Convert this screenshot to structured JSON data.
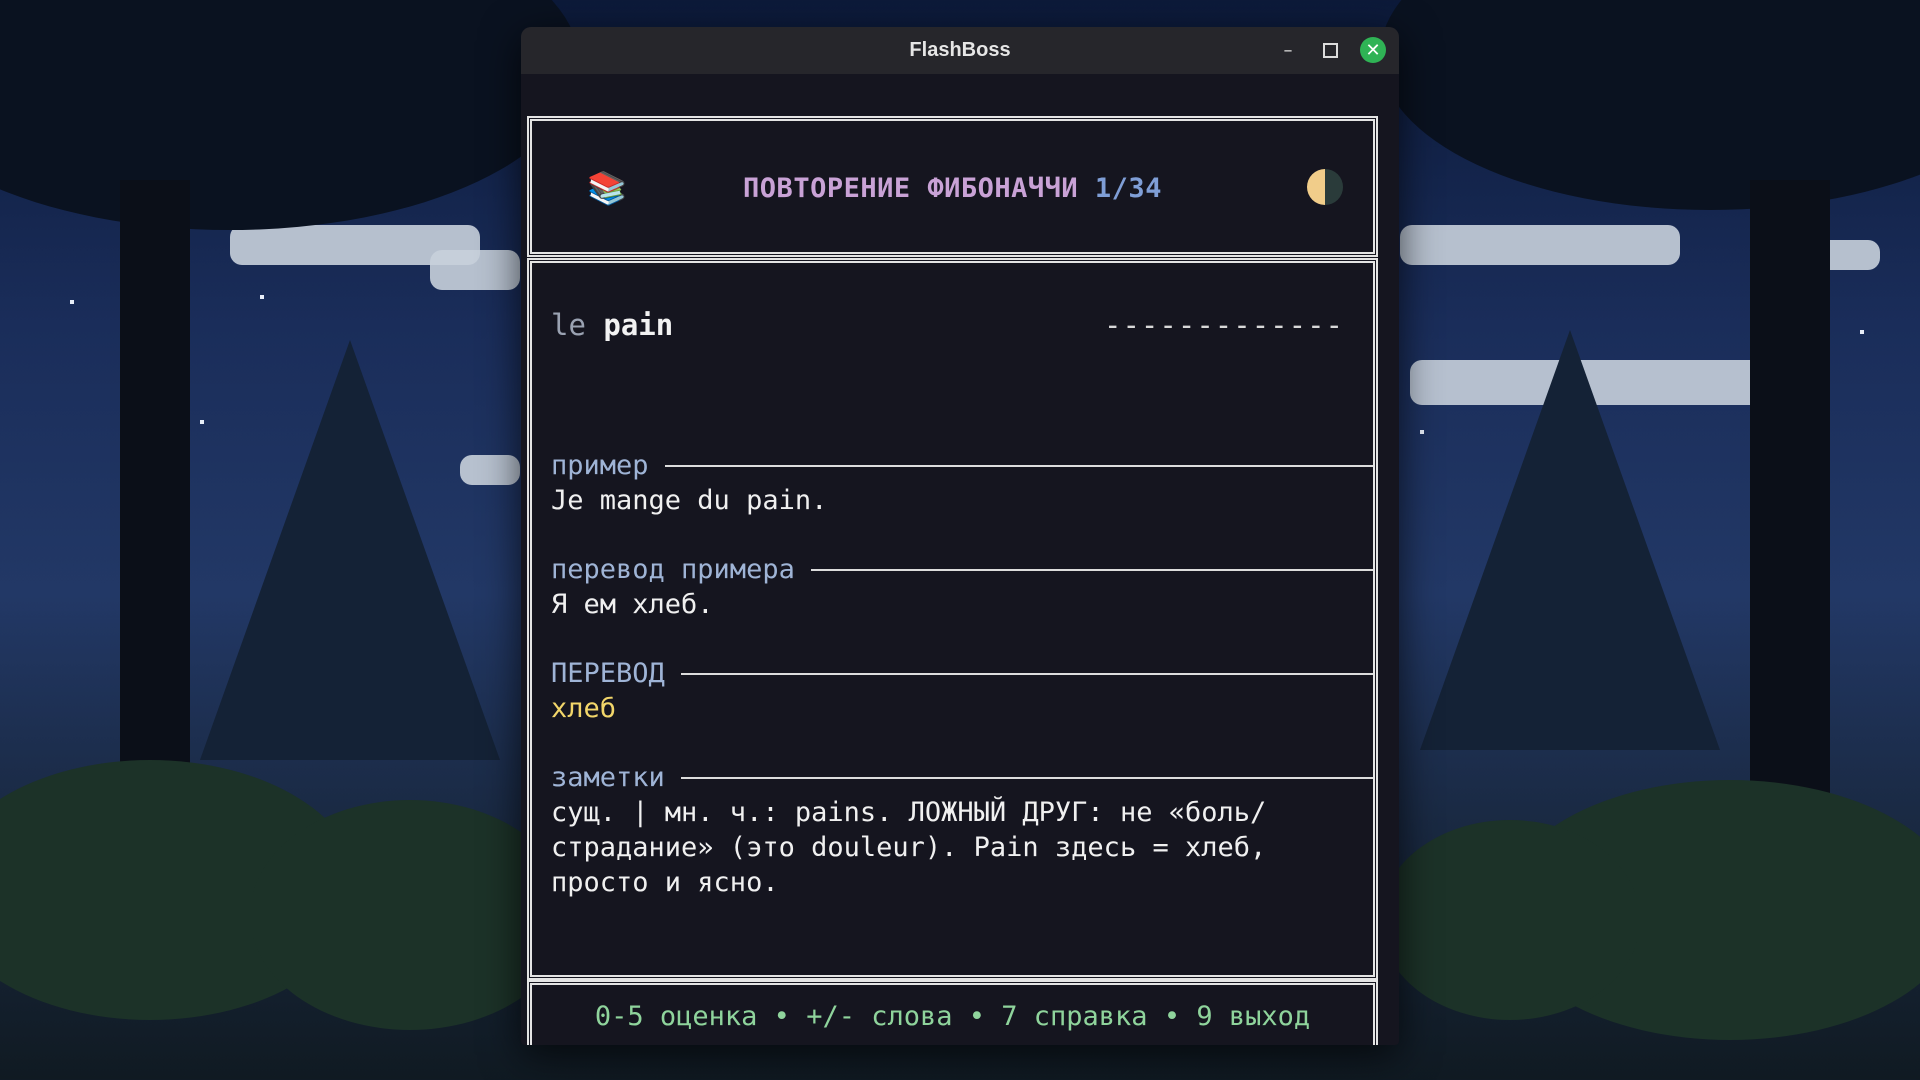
{
  "window": {
    "title": "FlashBoss",
    "minimize": "–",
    "close": "✕"
  },
  "header": {
    "book_icon": "📚",
    "title": "ПОВТОРЕНИЕ ФИБОНАЧЧИ",
    "progress": "1/34",
    "theme_icon": "moon-half-icon"
  },
  "card": {
    "article": "le",
    "word": "pain",
    "dashes": "-------------",
    "sections": [
      {
        "label": "пример",
        "text": "Je mange du pain."
      },
      {
        "label": "перевод примера",
        "text": "Я ем хлеб."
      },
      {
        "label": "ПЕРЕВОД",
        "text": "хлеб"
      },
      {
        "label": "заметки",
        "text": "сущ. | мн. ч.: pains. ЛОЖНЫЙ ДРУГ: не «боль/страдание» (это douleur). Pain здесь = хлеб, просто и ясно."
      }
    ]
  },
  "footer": {
    "hint": "0-5 оценка • +/- слова • 7 справка • 9 выход"
  },
  "colors": {
    "accent_title": "#c9a2d6",
    "accent_progress": "#7f9ed6",
    "translation": "#f2d66a",
    "footer": "#8fd49c",
    "close_button": "#2fb355"
  }
}
